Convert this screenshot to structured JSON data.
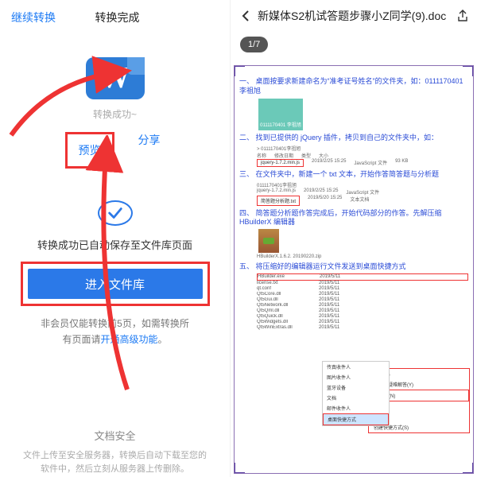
{
  "left": {
    "continue": "继续转换",
    "done": "转换完成",
    "word_letter": "W",
    "status": "转换成功~",
    "preview": "预览",
    "share": "分享",
    "saved_msg": "转换成功已自动保存至文件库页面",
    "enter_lib": "进入文件库",
    "note_a": "非会员仅能转换前5页，如需转换所",
    "note_b_pre": "有页面请",
    "note_b_link": "开通高级功能",
    "note_b_post": "。",
    "safe_title": "文档安全",
    "safe_body": "文件上传至安全服务器，转换后自动下载至您的软件中，然后立刻从服务器上传删除。"
  },
  "right": {
    "title": "新媒体S2机试答题步骤小Z同学(9).doc",
    "page": "1/7",
    "l1": "一、 桌面按要求新建命名为“准考证号姓名”的文件夹，如：0111170401 李祖旭",
    "folder": "0111170401\n李祖旭",
    "l2": "二、 找到已提供的 jQuery 插件，拷贝到自己的文件夹中，如：",
    "path2": "> 0111170401李祖旭",
    "hdr2": [
      "名称",
      "修改日期",
      "类型",
      "大小"
    ],
    "row2": [
      "jquery-1.7.2.min.js",
      "2019/2/25 15:25",
      "JavaScript 文件",
      "93 KB"
    ],
    "l3": "三、 在文件夹中，新建一个 txt 文本，开始作答简答题与分析题",
    "path3": "0111170401李祖旭",
    "row3a": [
      "jquery-1.7.2.min.js",
      "2019/2/25 15:25",
      "JavaScript 文件"
    ],
    "row3b": [
      "简答题分析题.txt",
      "2019/5/20 15:25",
      "文本文档"
    ],
    "l4": "四、 简答题分析题作答完成后，开始代码部分的作答。先解压缩 HBuilderX 编辑器",
    "rar_name": "HBuilderX.1.6.2.\n20190220.zip",
    "l5": "五、 将压缩好的编辑器运行文件发送到桌面快捷方式",
    "files": [
      [
        "HBuilder.exe",
        "2019/5/11"
      ],
      [
        "license.txt",
        "2019/5/11"
      ],
      [
        "qt.conf",
        "2019/5/11"
      ],
      [
        "Qt5Core.dll",
        "2019/5/11"
      ],
      [
        "Qt5Gui.dll",
        "2019/5/11"
      ],
      [
        "Qt5Network.dll",
        "2019/5/11"
      ],
      [
        "Qt5Qml.dll",
        "2019/5/11"
      ],
      [
        "Qt5Quick.dll",
        "2019/5/11"
      ],
      [
        "Qt5Widgets.dll",
        "2019/5/11"
      ],
      [
        "Qt5WinExtras.dll",
        "2019/5/11"
      ]
    ],
    "ctx": [
      "打开(O)",
      "兼容性疑难解答(Y)",
      "发送到(N)",
      "剪切(T)",
      "复制(C)",
      "创建快捷方式(S)"
    ],
    "sub": [
      "传真收件人",
      "图片收件人",
      "蓝牙设备",
      "文档",
      "邮件收件人",
      "桌面快捷方式"
    ]
  }
}
